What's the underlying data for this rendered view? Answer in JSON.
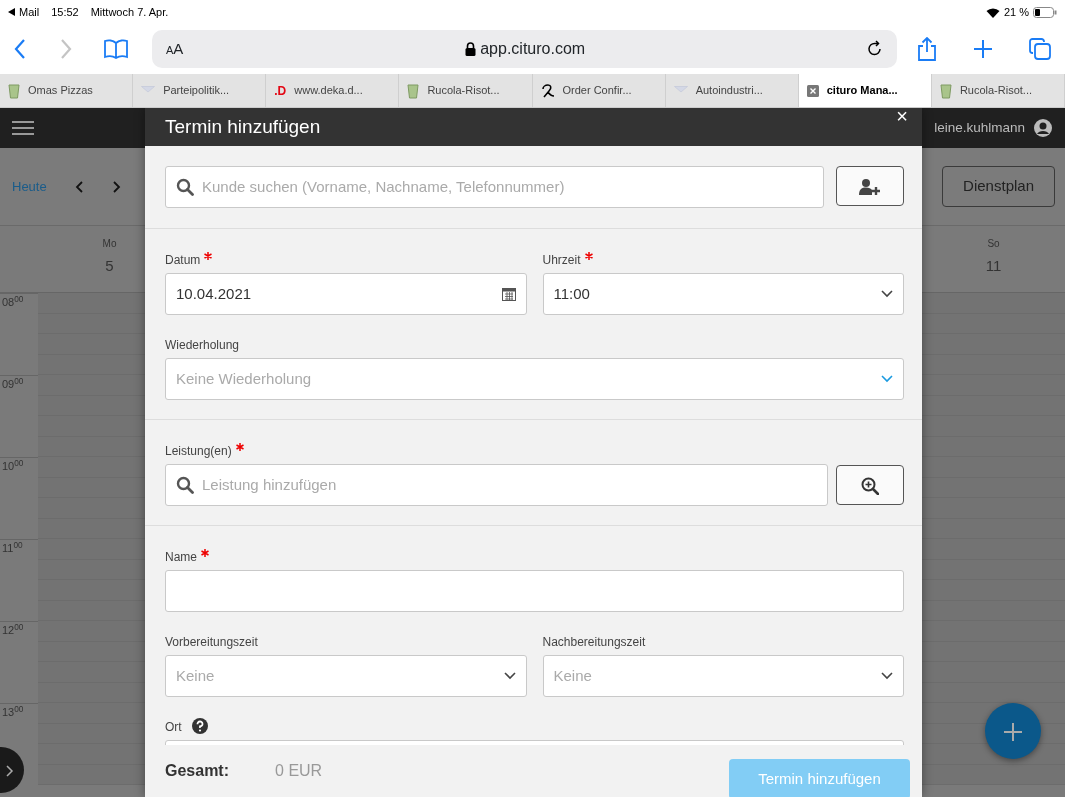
{
  "status_bar": {
    "back_label": "Mail",
    "time": "15:52",
    "date": "Mittwoch 7. Apr.",
    "battery": "21 %"
  },
  "browser": {
    "forward_disabled": true,
    "text_size": "AA",
    "url": "app.cituro.com"
  },
  "tabs": [
    {
      "label": "Omas Pizzas",
      "kind": "cup",
      "selected": false
    },
    {
      "label": "Parteipolitik...",
      "kind": "mail",
      "selected": false
    },
    {
      "label": "www.deka.d...",
      "kind": "text",
      "logo": ".D",
      "selected": false
    },
    {
      "label": "Rucola-Risot...",
      "kind": "cup",
      "selected": false
    },
    {
      "label": "Order Confir...",
      "kind": "r",
      "selected": false
    },
    {
      "label": "Autoindustri...",
      "kind": "mail",
      "selected": false
    },
    {
      "label": "cituro Mana...",
      "kind": "x",
      "selected": true
    },
    {
      "label": "Rucola-Risot...",
      "kind": "cup",
      "selected": false
    }
  ],
  "app": {
    "user": "leine.kuhlmann",
    "today": "Heute",
    "roster_button": "Dienstplan",
    "days": [
      {
        "weekday": "Mo",
        "date": "5"
      },
      {
        "weekday": "So",
        "date": "11"
      }
    ],
    "hours": [
      "08$^{00}$",
      "09$^{00}$",
      "10$^{00}$",
      "11$^{00}$",
      "12$^{00}$",
      "13$^{00}$"
    ]
  },
  "dialog": {
    "title": "Termin hinzufügen",
    "close": "×",
    "customer_search": {
      "placeholder": "Kunde suchen (Vorname, Nachname, Telefonnummer)"
    },
    "sections": [
      [
        [
          {
            "kind": "date",
            "label": "Datum",
            "required": true,
            "value": "10.04.2021"
          },
          {
            "kind": "select",
            "label": "Uhrzeit",
            "required": true,
            "value": "11:00"
          }
        ],
        [
          {
            "kind": "select",
            "label": "Wiederholung",
            "placeholder": "Keine Wiederholung",
            "accent": true
          }
        ]
      ],
      [
        [
          {
            "kind": "search",
            "label": "Leistung(en)",
            "required": true,
            "placeholder": "Leistung hinzufügen"
          }
        ]
      ],
      [
        [
          {
            "kind": "text",
            "label": "Name",
            "required": true
          }
        ],
        [
          {
            "kind": "select",
            "label": "Vorbereitungszeit",
            "placeholder": "Keine"
          },
          {
            "kind": "select",
            "label": "Nachbereitungszeit",
            "placeholder": "Keine"
          }
        ],
        [
          {
            "kind": "text",
            "label": "Ort",
            "help": true
          }
        ]
      ]
    ],
    "total_label": "Gesamt:",
    "total": "0 EUR",
    "submit": {
      "label": "Termin hinzufügen",
      "disabled": true
    }
  }
}
